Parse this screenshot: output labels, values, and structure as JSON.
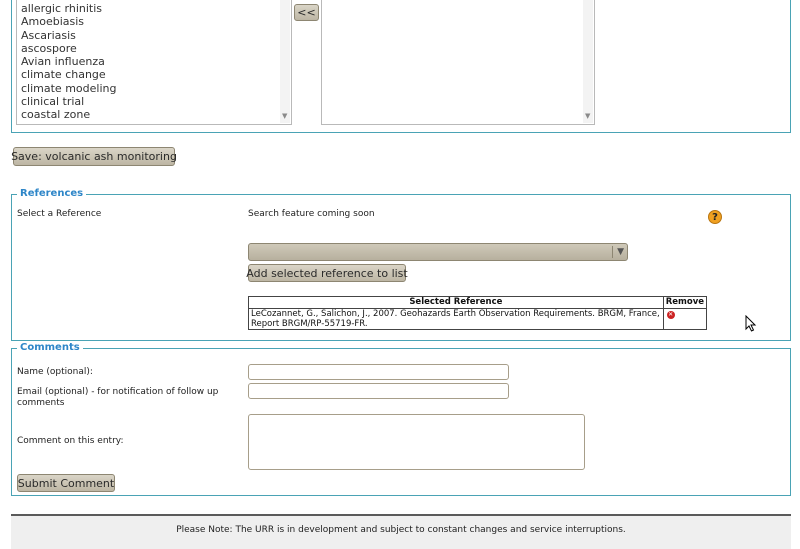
{
  "keywords": {
    "available": [
      "allergic rhinitis",
      "Amoebiasis",
      "Ascariasis",
      "ascospore",
      "Avian influenza",
      "climate change",
      "climate modeling",
      "clinical trial",
      "coastal zone"
    ],
    "move_left_label": "<<"
  },
  "save_button_label": "Save: volcanic ash monitoring",
  "references": {
    "legend": "References",
    "select_label": "Select a Reference",
    "search_note": "Search feature coming soon",
    "help_icon": "?",
    "add_button_label": "Add selected reference to list",
    "table": {
      "headers": [
        "Selected Reference",
        "Remove"
      ],
      "rows": [
        {
          "reference": "LeCozannet, G., Salichon, J., 2007. Geohazards Earth Observation Requirements. BRGM, France, Report BRGM/RP-55719-FR."
        }
      ]
    }
  },
  "comments": {
    "legend": "Comments",
    "name_label": "Name (optional):",
    "email_label": "Email (optional) - for notification of follow up comments",
    "comment_label": "Comment on this entry:",
    "submit_label": "Submit Comment"
  },
  "footer": {
    "notice": "Please Note: The URR is in development and subject to constant changes and service interruptions."
  },
  "colors": {
    "accent": "#2e86c8",
    "border": "#4aa3b5",
    "button": "#c9c3b2",
    "help_icon": "#f0a020",
    "remove_icon": "#cc2222"
  }
}
